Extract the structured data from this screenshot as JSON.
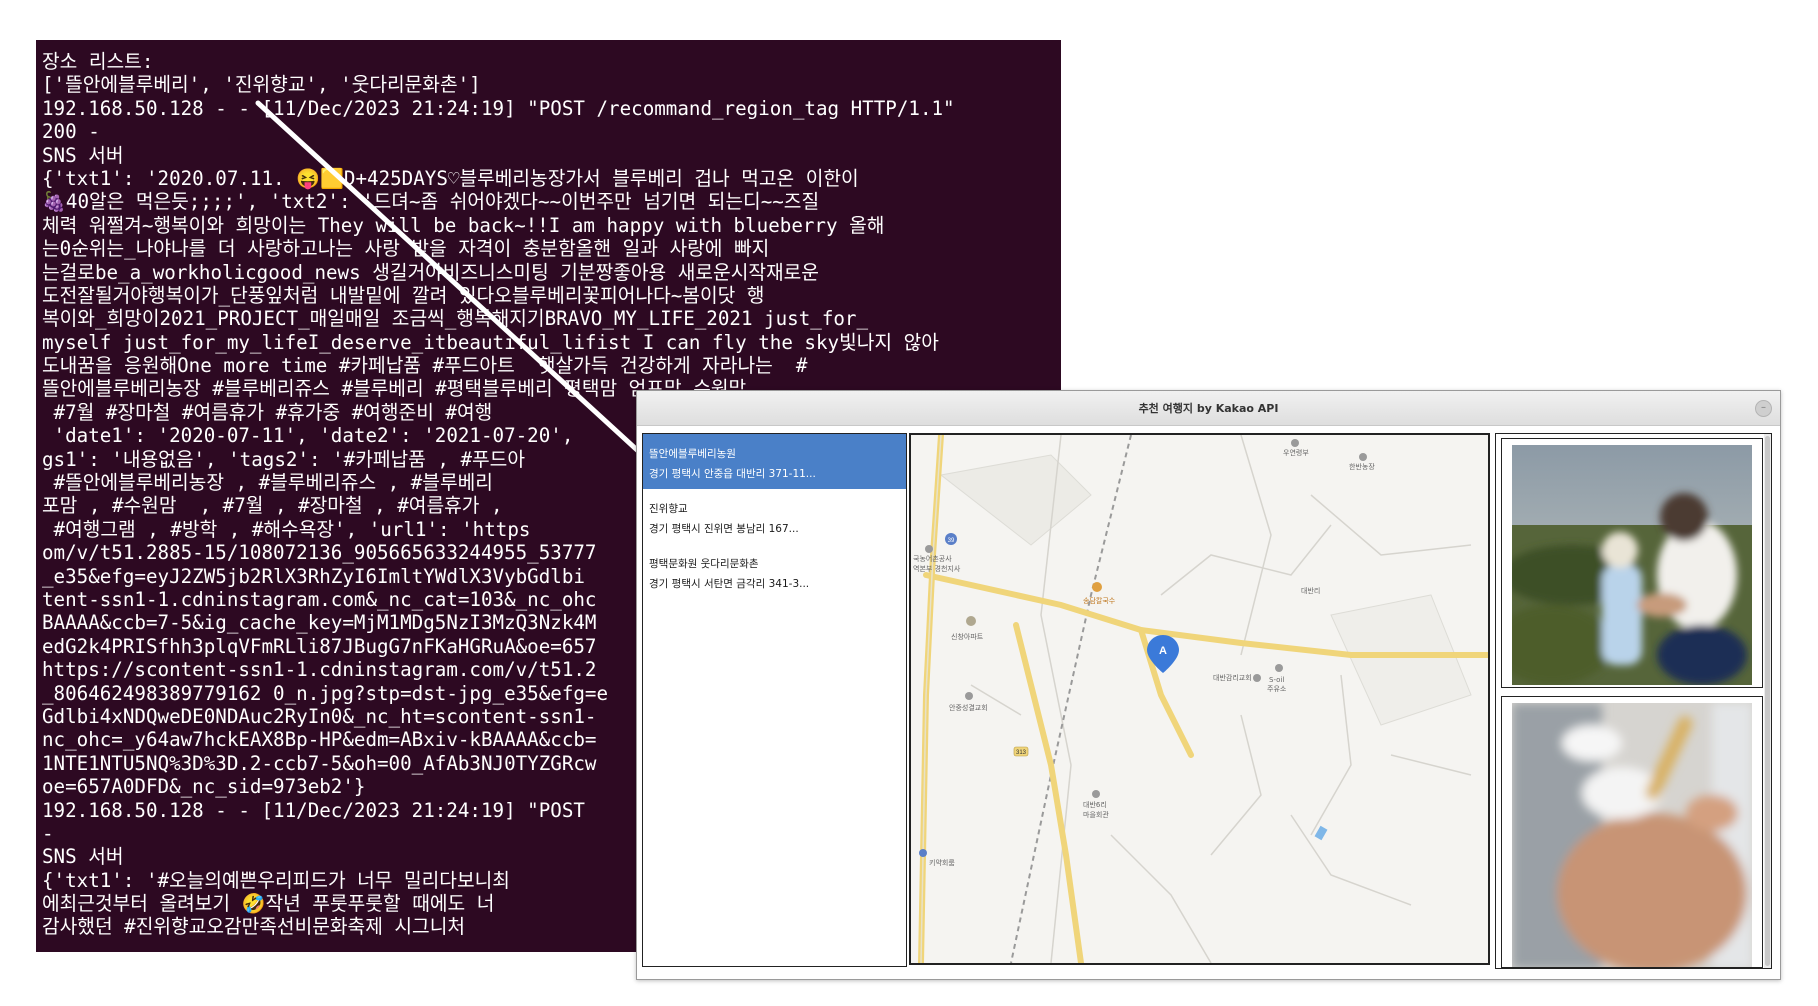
{
  "terminal": {
    "lines": [
      "장소 리스트:",
      "['뜰안에블루베리', '진위향교', '웃다리문화촌']",
      "192.168.50.128 - - [11/Dec/2023 21:24:19] \"POST /recommand_region_tag HTTP/1.1\"",
      "200 -",
      "SNS 서버",
      "{'txt1': '2020.07.11. 😝🟨D+425DAYS♡블루베리농장가서 블루베리 겁나 먹고온 이한이",
      "🍇40알은 먹은듯;;;;', 'txt2': '드뎌~좀 쉬어야겠다~~이번주만 넘기면 되는디~~즈질",
      "체력 워쩔겨~행복이와 희망이는 They will be back~!!I am happy with blueberry 올해",
      "는0순위는_나야나를 더 사랑하고나는 사랑 받을 자격이 충분함올핸 일과 사랑에 빠지",
      "는걸로be_a_workholicgood_news 생길거야비즈니스미팅 기분짱좋아용 새로운시작재로운",
      "도전잘될거야행복이가_단풍잎처럼 내발밑에 깔려 있다오블루베리꽃피어나다~봄이닷 행",
      "복이와_희망이2021_PROJECT_매일매일 조금씩_행복해지기BRAVO_MY_LIFE_2021 just_for_",
      "myself just_for_my_lifeI_deserve_itbeautiful_lifist I can fly the sky빛나지 않아",
      "도내꿈을 응원해One more time #카페납품 #푸드아트  햇살가득 건강하게 자라나는  #",
      "뜰안에블루베리농장 #블루베리쥬스 #블루베리 #평택블루베리 평택맘 엄프맘 수원맘",
      " #7월 #장마철 #여름휴가 #휴가중 #여행준비 #여행",
      " 'date1': '2020-07-11', 'date2': '2021-07-20',",
      "gs1': '내용없음', 'tags2': '#카페납품 , #푸드아",
      " #뜰안에블루베리농장 , #블루베리쥬스 , #블루베리",
      "포맘 , #수원맘  , #7월 , #장마철 , #여름휴가 ,",
      " #여행그램 , #방학 , #해수욕장', 'url1': 'https",
      "om/v/t51.2885-15/108072136_905665633244955_53777",
      "_e35&efg=eyJ2ZW5jb2RlX3RhZyI6ImltYWdlX3VybGdlbi",
      "tent-ssn1-1.cdninstagram.com&_nc_cat=103&_nc_ohc",
      "BAAAA&ccb=7-5&ig_cache_key=MjM1MDg5NzI3MzQ3Nzk4M",
      "edG2k4PRISfhh3plqVFmRLli87JBugG7nFKaHGRuA&oe=657",
      "https://scontent-ssn1-1.cdninstagram.com/v/t51.2",
      "_806462498389779162 0_n.jpg?stp=dst-jpg_e35&efg=e",
      "Gdlbi4xNDQweDE0NDAuc2RyIn0&_nc_ht=scontent-ssn1-",
      "nc_ohc=_y64aw7hckEAX8Bp-HP&edm=ABxiv-kBAAAA&ccb=",
      "1NTE1NTU5NQ%3D%3D.2-ccb7-5&oh=00_AfAb3NJ0TYZGRcw",
      "oe=657A0DFD&_nc_sid=973eb2'}",
      "192.168.50.128 - - [11/Dec/2023 21:24:19] \"POST",
      "-",
      "SNS 서버",
      "{'txt1': '#오늘의예쁜우리피드가 너무 밀리다보니최",
      "에최근것부터 올려보기 🤣작년 푸룻푸룻할 때에도 너",
      "감사했던 #진위향교오감만족선비문화축제 시그니처"
    ]
  },
  "window": {
    "title": "추천 여행지 by Kakao API",
    "close_label": "–"
  },
  "places": [
    {
      "name": "뜰안에블루베리농원",
      "address": "경기 평택시 안중읍 대반리 371-11..."
    },
    {
      "name": "진위향교",
      "address": "경기 평택시 진위면 봉남리 167..."
    },
    {
      "name": "평택문화원 웃다리문화촌",
      "address": "경기 평택시 서탄면 금각리 341-3..."
    }
  ],
  "map": {
    "marker_label": "A",
    "labels": {
      "l0": "우연령부",
      "l1": "한반농장",
      "l2": "국농어촌공사",
      "l3": "역본부 경천지사",
      "l4": "송담칼국수",
      "l5": "대반리",
      "l6": "신창아파트",
      "l7": "대반감리교회",
      "l8": "S-oil",
      "l9": "주유소",
      "l10": "안중성결교회",
      "l11": "대반6리",
      "l12": "마을회관",
      "l13": "키약회룸"
    },
    "routes": [
      "39",
      "313"
    ]
  },
  "colors": {
    "terminal_bg": "#2d0922",
    "selected_item": "#4a80c8",
    "map_marker": "#3b7ad9"
  }
}
